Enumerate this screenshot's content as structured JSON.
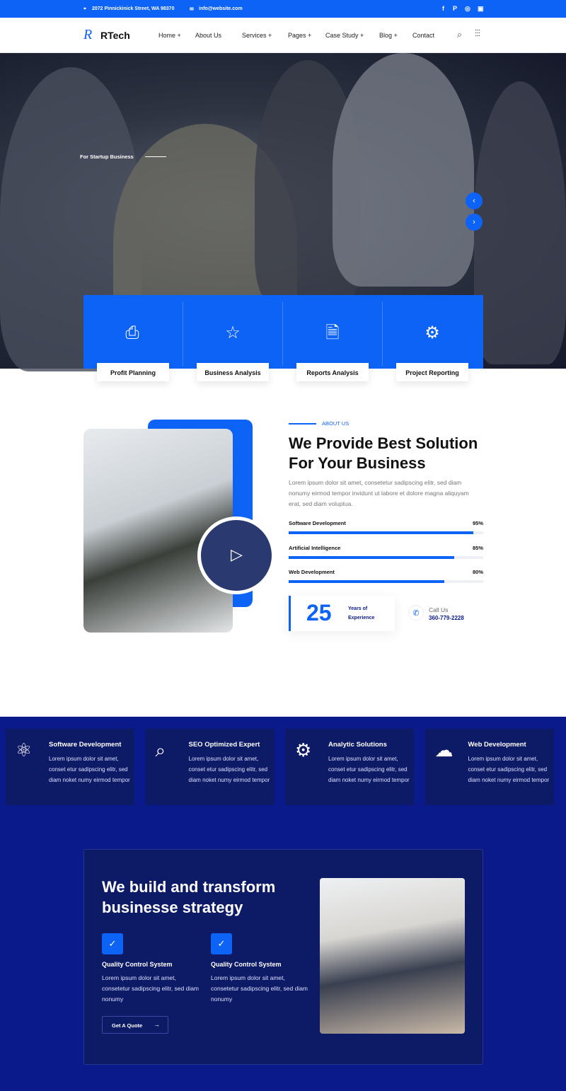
{
  "topbar": {
    "address": "2072 Pinnickinick Street, WA 98370",
    "email": "info@website.com",
    "social": [
      "facebook-icon",
      "pinterest-icon",
      "whatsapp-icon",
      "instagram-icon"
    ]
  },
  "nav": {
    "logo": "RTech",
    "items": [
      "Home +",
      "About Us",
      "Services +",
      "Pages +",
      "Case Study +",
      "Blog +",
      "Contact"
    ]
  },
  "hero": {
    "tagline": "For Startup Business"
  },
  "features": [
    {
      "label": "Profit Planning",
      "icon": "planning-icon"
    },
    {
      "label": "Business Analysis",
      "icon": "analysis-icon"
    },
    {
      "label": "Reports Analysis",
      "icon": "report-icon"
    },
    {
      "label": "Project Reporting",
      "icon": "reporting-icon"
    }
  ],
  "about": {
    "kicker": "ABOUT US",
    "title1": "We Provide Best Solution",
    "title2": "For Your Business",
    "text": "Lorem ipsum dolor sit amet, consetetur sadipscing elitr, sed diam nonumy eirmod tempor invidunt ut labore et dolore magna aliquyam erat, sed diam voluptua.",
    "skills": [
      {
        "name": "Software Development",
        "pct": "95%",
        "value": 95
      },
      {
        "name": "Artificial Intelligence",
        "pct": "85%",
        "value": 85
      },
      {
        "name": "Web Development",
        "pct": "80%",
        "value": 80
      }
    ],
    "years": "25",
    "years_label1": "Years of",
    "years_label2": "Experience",
    "call_label": "Call Us",
    "phone": "360-779-2228"
  },
  "services": [
    {
      "title": "Software Development",
      "text": "Lorem ipsum dolor sit amet, conset etur sadipscing elitr, sed diam noket numy eirmod tempor",
      "icon": "atom-icon"
    },
    {
      "title": "SEO Optimized Expert",
      "text": "Lorem ipsum dolor sit amet, conset etur sadipscing elitr, sed diam noket numy eirmod tempor",
      "icon": "seo-icon"
    },
    {
      "title": "Analytic Solutions",
      "text": "Lorem ipsum dolor sit amet, conset etur sadipscing elitr, sed diam noket numy eirmod tempor",
      "icon": "gear-cycle-icon"
    },
    {
      "title": "Web Development",
      "text": "Lorem ipsum dolor sit amet, conset etur sadipscing elitr, sed diam noket numy eirmod tempor",
      "icon": "cloud-web-icon"
    }
  ],
  "strategy": {
    "title1": "We build and transform",
    "title2": "businesse strategy",
    "points": [
      {
        "title": "Quality Control System",
        "text": "Lorem ipsum dolor sit amet, consetetur sadipscing elitr, sed diam nonumy"
      },
      {
        "title": "Quality Control System",
        "text": "Lorem ipsum dolor sit amet, consetetur sadipscing elitr, sed diam nonumy"
      }
    ],
    "cta": "Get A Quote"
  },
  "colors": {
    "accent": "#0d63f6",
    "navy": "#0b1a8a",
    "card": "#0d1a66"
  }
}
